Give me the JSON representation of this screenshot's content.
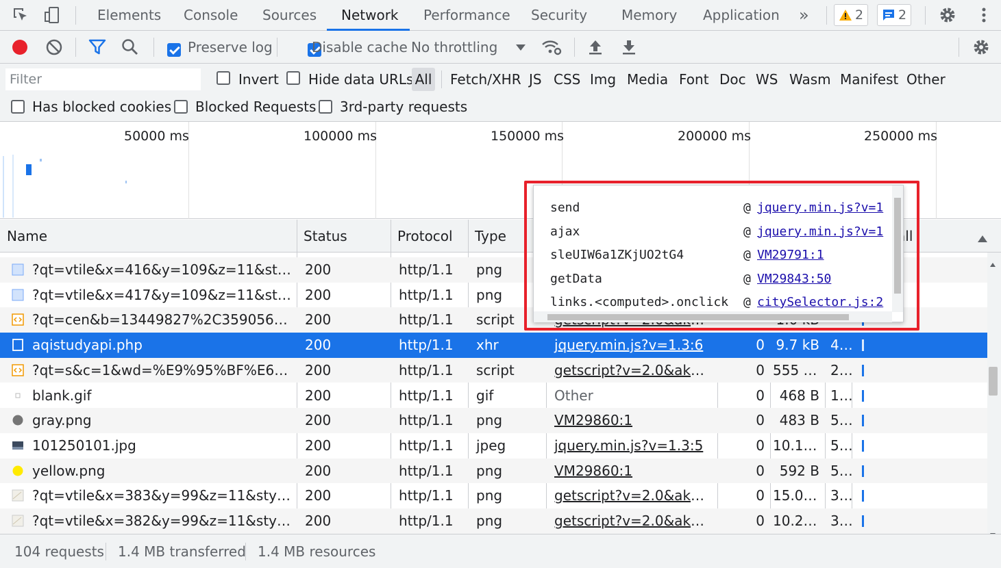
{
  "tabs": {
    "items": [
      "Elements",
      "Console",
      "Sources",
      "Network",
      "Performance",
      "Security",
      "Memory",
      "Application"
    ],
    "more": "»",
    "warnings": "2",
    "messages": "2"
  },
  "toolbar": {
    "preserve_log": "Preserve log",
    "disable_cache": "Disable cache",
    "throttling": "No throttling"
  },
  "filter": {
    "placeholder": "Filter",
    "invert": "Invert",
    "hide_data_urls": "Hide data URLs",
    "types": [
      "All",
      "Fetch/XHR",
      "JS",
      "CSS",
      "Img",
      "Media",
      "Font",
      "Doc",
      "WS",
      "Wasm",
      "Manifest",
      "Other"
    ],
    "has_blocked_cookies": "Has blocked cookies",
    "blocked_requests": "Blocked Requests",
    "third_party": "3rd-party requests"
  },
  "overview": {
    "ticks": [
      "50000 ms",
      "100000 ms",
      "150000 ms",
      "200000 ms",
      "250000 ms"
    ]
  },
  "table": {
    "headers": [
      "Name",
      "Status",
      "Protocol",
      "Type",
      "all"
    ],
    "rows": [
      {
        "name": "?qt=vtile&x=416&y=109&z=11&styles...",
        "status": "200",
        "protocol": "http/1.1",
        "type": "png",
        "initiator": "",
        "size_a": "",
        "size_b": "",
        "time": "",
        "icon": "img"
      },
      {
        "name": "?qt=vtile&x=417&y=109&z=11&styles...",
        "status": "200",
        "protocol": "http/1.1",
        "type": "png",
        "initiator": "",
        "size_a": "",
        "size_b": "",
        "time": "",
        "icon": "img"
      },
      {
        "name": "?qt=cen&b=13449827%2C3590569.89...",
        "status": "200",
        "protocol": "http/1.1",
        "type": "script",
        "initiator": "getscript?v=2.0&ak=V...",
        "size_a": "",
        "size_b": "1.0 kB",
        "time": "",
        "icon": "script"
      },
      {
        "name": "aqistudyapi.php",
        "status": "200",
        "protocol": "http/1.1",
        "type": "xhr",
        "initiator": "jquery.min.js?v=1.3:6",
        "size_a": "0",
        "size_b": "9.7 kB",
        "time": "4...",
        "icon": "doc",
        "selected": true
      },
      {
        "name": "?qt=s&c=1&wd=%E9%95%BF%E6%B2...",
        "status": "200",
        "protocol": "http/1.1",
        "type": "script",
        "initiator": "getscript?v=2.0&ak=V...",
        "size_a": "0",
        "size_b": "555 kB",
        "time": "2...",
        "icon": "script"
      },
      {
        "name": "blank.gif",
        "status": "200",
        "protocol": "http/1.1",
        "type": "gif",
        "initiator": "Other",
        "size_a": "0",
        "size_b": "468 B",
        "time": "1...",
        "icon": "blank"
      },
      {
        "name": "gray.png",
        "status": "200",
        "protocol": "http/1.1",
        "type": "png",
        "initiator": "VM29860:1",
        "size_a": "0",
        "size_b": "483 B",
        "time": "5...",
        "icon": "gray"
      },
      {
        "name": "101250101.jpg",
        "status": "200",
        "protocol": "http/1.1",
        "type": "jpeg",
        "initiator": "jquery.min.js?v=1.3:5",
        "size_a": "0",
        "size_b": "10.1 ...",
        "time": "5...",
        "icon": "jpg"
      },
      {
        "name": "yellow.png",
        "status": "200",
        "protocol": "http/1.1",
        "type": "png",
        "initiator": "VM29860:1",
        "size_a": "0",
        "size_b": "592 B",
        "time": "5...",
        "icon": "yellow"
      },
      {
        "name": "?qt=vtile&x=383&y=99&z=11&styles...",
        "status": "200",
        "protocol": "http/1.1",
        "type": "png",
        "initiator": "getscript?v=2.0&ak=V...",
        "size_a": "0",
        "size_b": "15.0 ...",
        "time": "3...",
        "icon": "tile"
      },
      {
        "name": "?qt=vtile&x=382&y=99&z=11&styles...",
        "status": "200",
        "protocol": "http/1.1",
        "type": "png",
        "initiator": "getscript?v=2.0&ak=V...",
        "size_a": "0",
        "size_b": "10.2 ...",
        "time": "3...",
        "icon": "tile"
      }
    ]
  },
  "popover": {
    "stack": [
      {
        "fn": "send",
        "at": "@",
        "src": "jquery.min.js?v=1"
      },
      {
        "fn": "ajax",
        "at": "@",
        "src": "jquery.min.js?v=1"
      },
      {
        "fn": "sleUIW6a1ZKjUO2tG4",
        "at": "@",
        "src": "VM29791:1"
      },
      {
        "fn": "getData",
        "at": "@",
        "src": "VM29843:50"
      },
      {
        "fn": "links.<computed>.onclick",
        "at": "@",
        "src": "citySelector.js:2"
      }
    ]
  },
  "status": {
    "requests": "104 requests",
    "transferred": "1.4 MB transferred",
    "resources": "1.4 MB resources"
  },
  "colors": {
    "accent": "#1a73e8",
    "highlight": "#e8212b",
    "record": "#e8212b"
  }
}
